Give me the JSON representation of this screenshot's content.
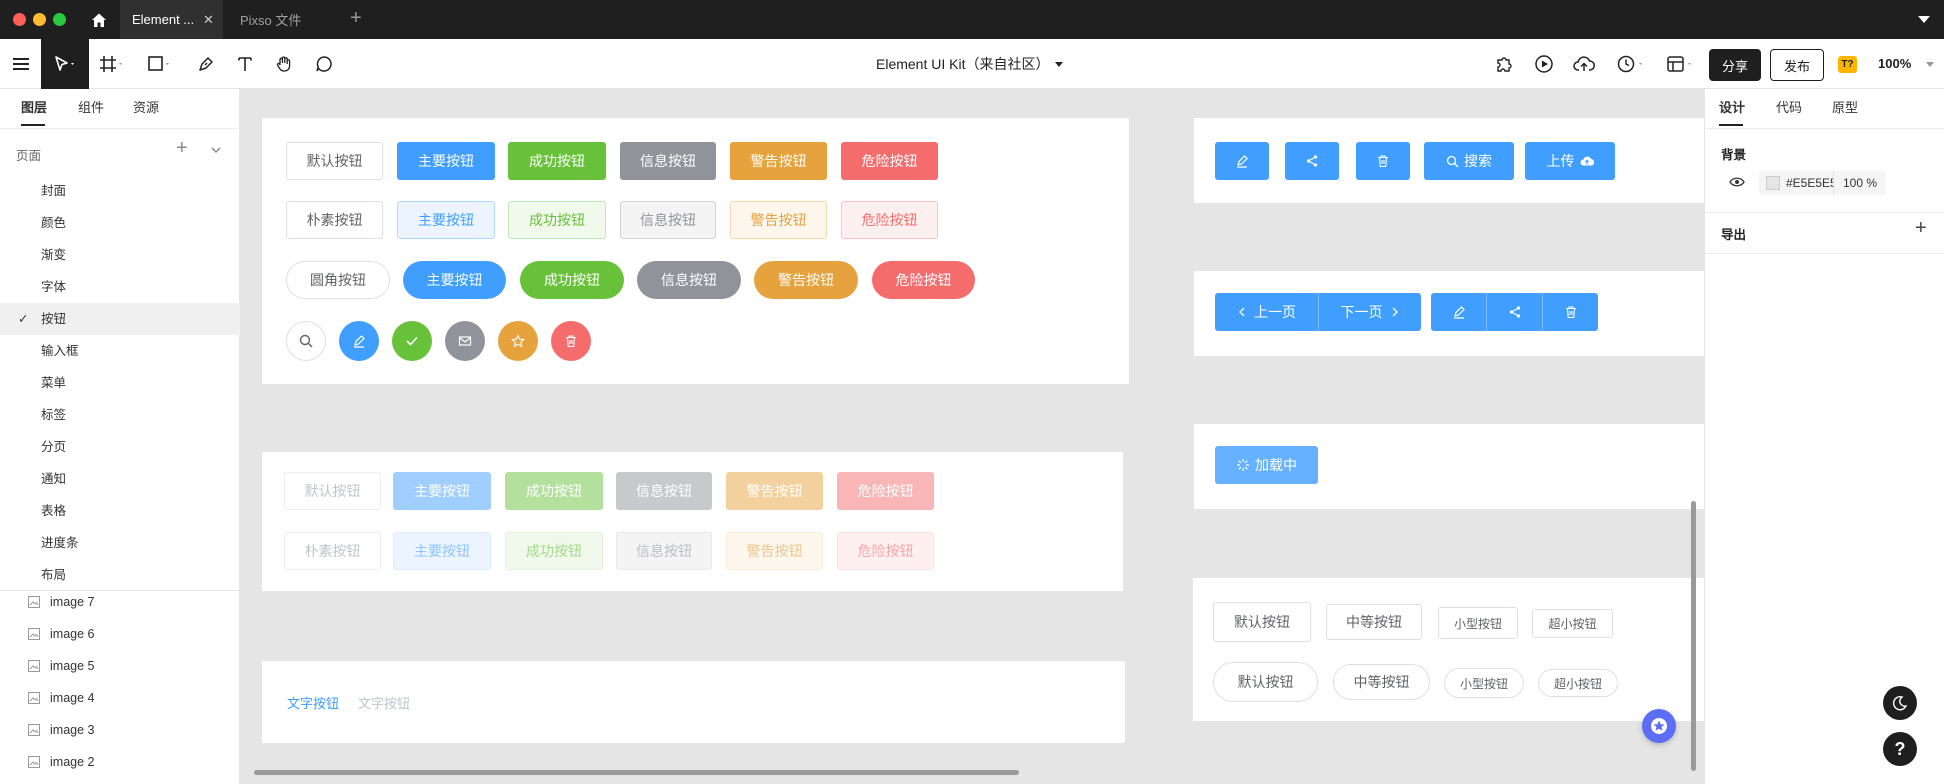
{
  "window": {
    "tabs": [
      {
        "label": "Element ..."
      },
      {
        "label": "Pixso 文件"
      }
    ]
  },
  "toolbar": {
    "doc_title": "Element UI Kit（来自社区）",
    "share_label": "分享",
    "publish_label": "发布",
    "badge": "T?",
    "zoom": "100%"
  },
  "left_panel": {
    "tabs": [
      "图层",
      "组件",
      "资源"
    ],
    "pages_label": "页面",
    "pages": [
      "封面",
      "颜色",
      "渐变",
      "字体",
      "按钮",
      "输入框",
      "菜单",
      "标签",
      "分页",
      "通知",
      "表格",
      "进度条",
      "布局"
    ],
    "selected_page": "按钮",
    "layers": [
      "image 7",
      "image 6",
      "image 5",
      "image 4",
      "image 3",
      "image 2"
    ]
  },
  "right_panel": {
    "tabs": [
      "设计",
      "代码",
      "原型"
    ],
    "background_label": "背景",
    "bg_hex": "#E5E5E5",
    "bg_opacity": "100 %",
    "export_label": "导出"
  },
  "canvas": {
    "row_basic": [
      "默认按钮",
      "主要按钮",
      "成功按钮",
      "信息按钮",
      "警告按钮",
      "危险按钮"
    ],
    "row_plain": [
      "朴素按钮",
      "主要按钮",
      "成功按钮",
      "信息按钮",
      "警告按钮",
      "危险按钮"
    ],
    "row_round": [
      "圆角按钮",
      "主要按钮",
      "成功按钮",
      "信息按钮",
      "警告按钮",
      "危险按钮"
    ],
    "row_disabled": [
      "默认按钮",
      "主要按钮",
      "成功按钮",
      "信息按钮",
      "警告按钮",
      "危险按钮"
    ],
    "row_disabled_plain": [
      "朴素按钮",
      "主要按钮",
      "成功按钮",
      "信息按钮",
      "警告按钮",
      "危险按钮"
    ],
    "text_buttons": [
      "文字按钮",
      "文字按钮"
    ],
    "search_label": "搜索",
    "upload_label": "上传",
    "prev_label": "上一页",
    "next_label": "下一页",
    "loading_label": "加载中",
    "size_row": [
      "默认按钮",
      "中等按钮",
      "小型按钮",
      "超小按钮"
    ],
    "size_row_round": [
      "默认按钮",
      "中等按钮",
      "小型按钮",
      "超小按钮"
    ]
  },
  "colors": {
    "primary": "#409EFF",
    "success": "#67C23A",
    "info": "#909399",
    "warning": "#E6A23C",
    "danger": "#F56C6C"
  }
}
